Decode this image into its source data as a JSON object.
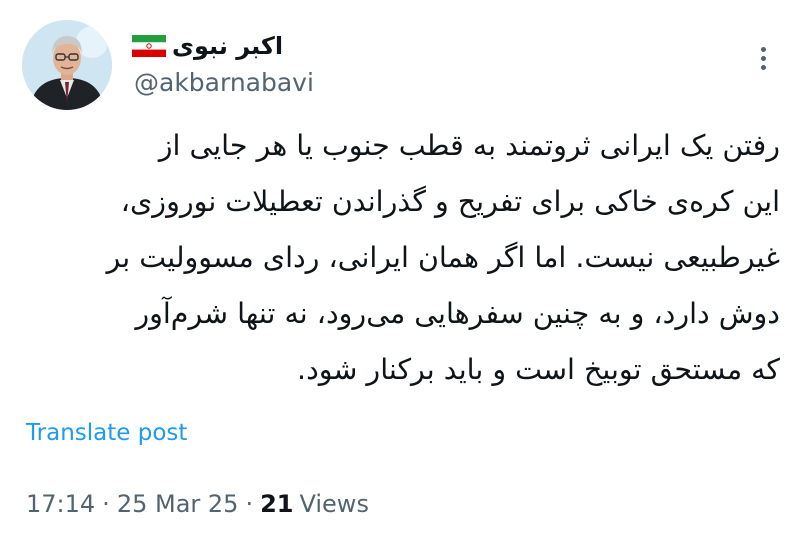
{
  "author": {
    "display_name": "اکبر نبوی",
    "handle": "@akbarnabavi",
    "flag_icon": "iran-flag-icon",
    "avatar_icon": "profile-photo"
  },
  "tweet": {
    "text_lines": [
      "رفتن یک ایرانی ثروتمند به قطب جنوب یا هر جایی از",
      "این کره‌ی خاکی برای تفریح و گذراندن تعطیلات نوروزی،",
      "غیرطبیعی نیست. اما اگر همان ایرانی، ردای مسوولیت بر",
      "دوش دارد، و به چنین سفرهایی می‌رود، نه تنها شرم‌آور",
      "که مستحق توبیخ است و باید برکنار شود."
    ]
  },
  "translate_label": "Translate post",
  "meta": {
    "time": "17:14",
    "separator": "·",
    "date": "25 Mar 25",
    "views_count": "21",
    "views_label": "Views"
  },
  "colors": {
    "text": "#0f1419",
    "secondary": "#536471",
    "link": "#1d9bf0"
  }
}
